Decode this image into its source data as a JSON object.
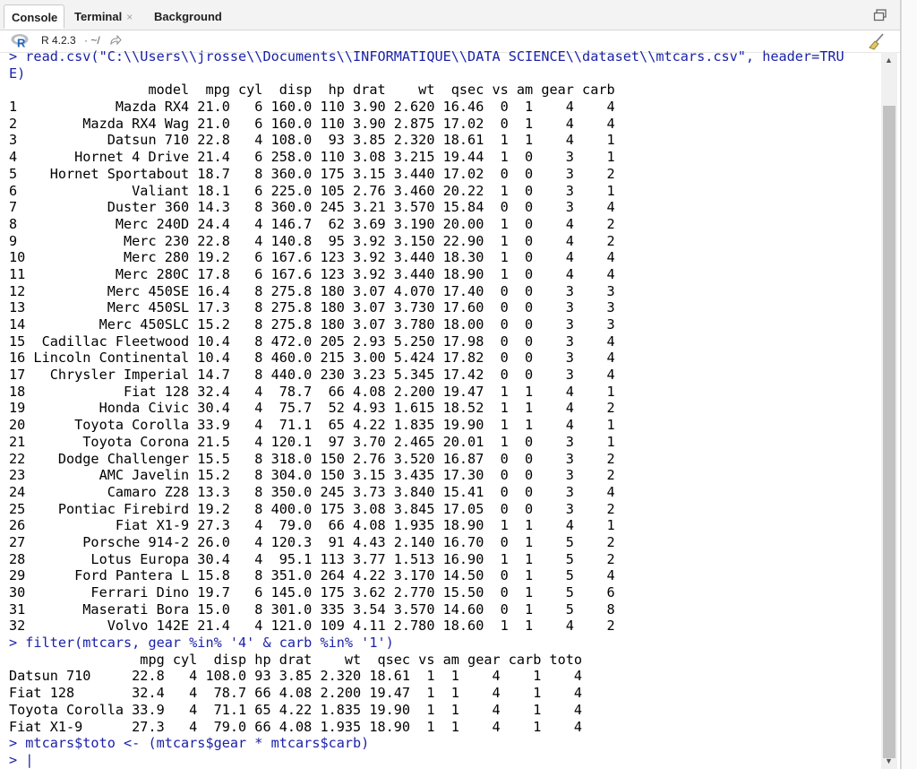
{
  "tabs": [
    {
      "label": "Console",
      "active": true
    },
    {
      "label": "Terminal",
      "active": false
    },
    {
      "label": "Background Jobs",
      "active": false
    }
  ],
  "close_glyph": "×",
  "subbar": {
    "r_version": "R 4.2.3",
    "path": "· ~/"
  },
  "icons": [
    "r-logo-icon",
    "path-arrow-icon",
    "maximize-icon",
    "broom-clear-icon"
  ],
  "colors": {
    "command_text": "#1a22a8",
    "tab_bg": "#f3f3f3"
  },
  "console": {
    "lines": [
      {
        "type": "cmd",
        "text": "> read.csv(\"C:\\\\Users\\\\jrosse\\\\Documents\\\\INFORMATIQUE\\\\DATA SCIENCE\\\\dataset\\\\mtcars.csv\", header=TRU"
      },
      {
        "type": "cmd",
        "text": "E)"
      },
      {
        "type": "out",
        "text": "                 model  mpg cyl  disp  hp drat    wt  qsec vs am gear carb"
      },
      {
        "type": "out",
        "text": "1            Mazda RX4 21.0   6 160.0 110 3.90 2.620 16.46  0  1    4    4"
      },
      {
        "type": "out",
        "text": "2        Mazda RX4 Wag 21.0   6 160.0 110 3.90 2.875 17.02  0  1    4    4"
      },
      {
        "type": "out",
        "text": "3           Datsun 710 22.8   4 108.0  93 3.85 2.320 18.61  1  1    4    1"
      },
      {
        "type": "out",
        "text": "4       Hornet 4 Drive 21.4   6 258.0 110 3.08 3.215 19.44  1  0    3    1"
      },
      {
        "type": "out",
        "text": "5    Hornet Sportabout 18.7   8 360.0 175 3.15 3.440 17.02  0  0    3    2"
      },
      {
        "type": "out",
        "text": "6              Valiant 18.1   6 225.0 105 2.76 3.460 20.22  1  0    3    1"
      },
      {
        "type": "out",
        "text": "7           Duster 360 14.3   8 360.0 245 3.21 3.570 15.84  0  0    3    4"
      },
      {
        "type": "out",
        "text": "8            Merc 240D 24.4   4 146.7  62 3.69 3.190 20.00  1  0    4    2"
      },
      {
        "type": "out",
        "text": "9             Merc 230 22.8   4 140.8  95 3.92 3.150 22.90  1  0    4    2"
      },
      {
        "type": "out",
        "text": "10            Merc 280 19.2   6 167.6 123 3.92 3.440 18.30  1  0    4    4"
      },
      {
        "type": "out",
        "text": "11           Merc 280C 17.8   6 167.6 123 3.92 3.440 18.90  1  0    4    4"
      },
      {
        "type": "out",
        "text": "12          Merc 450SE 16.4   8 275.8 180 3.07 4.070 17.40  0  0    3    3"
      },
      {
        "type": "out",
        "text": "13          Merc 450SL 17.3   8 275.8 180 3.07 3.730 17.60  0  0    3    3"
      },
      {
        "type": "out",
        "text": "14         Merc 450SLC 15.2   8 275.8 180 3.07 3.780 18.00  0  0    3    3"
      },
      {
        "type": "out",
        "text": "15  Cadillac Fleetwood 10.4   8 472.0 205 2.93 5.250 17.98  0  0    3    4"
      },
      {
        "type": "out",
        "text": "16 Lincoln Continental 10.4   8 460.0 215 3.00 5.424 17.82  0  0    3    4"
      },
      {
        "type": "out",
        "text": "17   Chrysler Imperial 14.7   8 440.0 230 3.23 5.345 17.42  0  0    3    4"
      },
      {
        "type": "out",
        "text": "18            Fiat 128 32.4   4  78.7  66 4.08 2.200 19.47  1  1    4    1"
      },
      {
        "type": "out",
        "text": "19         Honda Civic 30.4   4  75.7  52 4.93 1.615 18.52  1  1    4    2"
      },
      {
        "type": "out",
        "text": "20      Toyota Corolla 33.9   4  71.1  65 4.22 1.835 19.90  1  1    4    1"
      },
      {
        "type": "out",
        "text": "21       Toyota Corona 21.5   4 120.1  97 3.70 2.465 20.01  1  0    3    1"
      },
      {
        "type": "out",
        "text": "22    Dodge Challenger 15.5   8 318.0 150 2.76 3.520 16.87  0  0    3    2"
      },
      {
        "type": "out",
        "text": "23         AMC Javelin 15.2   8 304.0 150 3.15 3.435 17.30  0  0    3    2"
      },
      {
        "type": "out",
        "text": "24          Camaro Z28 13.3   8 350.0 245 3.73 3.840 15.41  0  0    3    4"
      },
      {
        "type": "out",
        "text": "25    Pontiac Firebird 19.2   8 400.0 175 3.08 3.845 17.05  0  0    3    2"
      },
      {
        "type": "out",
        "text": "26           Fiat X1-9 27.3   4  79.0  66 4.08 1.935 18.90  1  1    4    1"
      },
      {
        "type": "out",
        "text": "27       Porsche 914-2 26.0   4 120.3  91 4.43 2.140 16.70  0  1    5    2"
      },
      {
        "type": "out",
        "text": "28        Lotus Europa 30.4   4  95.1 113 3.77 1.513 16.90  1  1    5    2"
      },
      {
        "type": "out",
        "text": "29      Ford Pantera L 15.8   8 351.0 264 4.22 3.170 14.50  0  1    5    4"
      },
      {
        "type": "out",
        "text": "30        Ferrari Dino 19.7   6 145.0 175 3.62 2.770 15.50  0  1    5    6"
      },
      {
        "type": "out",
        "text": "31       Maserati Bora 15.0   8 301.0 335 3.54 3.570 14.60  0  1    5    8"
      },
      {
        "type": "out",
        "text": "32          Volvo 142E 21.4   4 121.0 109 4.11 2.780 18.60  1  1    4    2"
      },
      {
        "type": "cmd",
        "text": "> filter(mtcars, gear %in% '4' & carb %in% '1')"
      },
      {
        "type": "out",
        "text": "                mpg cyl  disp hp drat    wt  qsec vs am gear carb toto"
      },
      {
        "type": "out",
        "text": "Datsun 710     22.8   4 108.0 93 3.85 2.320 18.61  1  1    4    1    4"
      },
      {
        "type": "out",
        "text": "Fiat 128       32.4   4  78.7 66 4.08 2.200 19.47  1  1    4    1    4"
      },
      {
        "type": "out",
        "text": "Toyota Corolla 33.9   4  71.1 65 4.22 1.835 19.90  1  1    4    1    4"
      },
      {
        "type": "out",
        "text": "Fiat X1-9      27.3   4  79.0 66 4.08 1.935 18.90  1  1    4    1    4"
      },
      {
        "type": "cmd",
        "text": "> mtcars$toto <- (mtcars$gear * mtcars$carb)"
      },
      {
        "type": "cmd",
        "text": "> |"
      }
    ]
  }
}
